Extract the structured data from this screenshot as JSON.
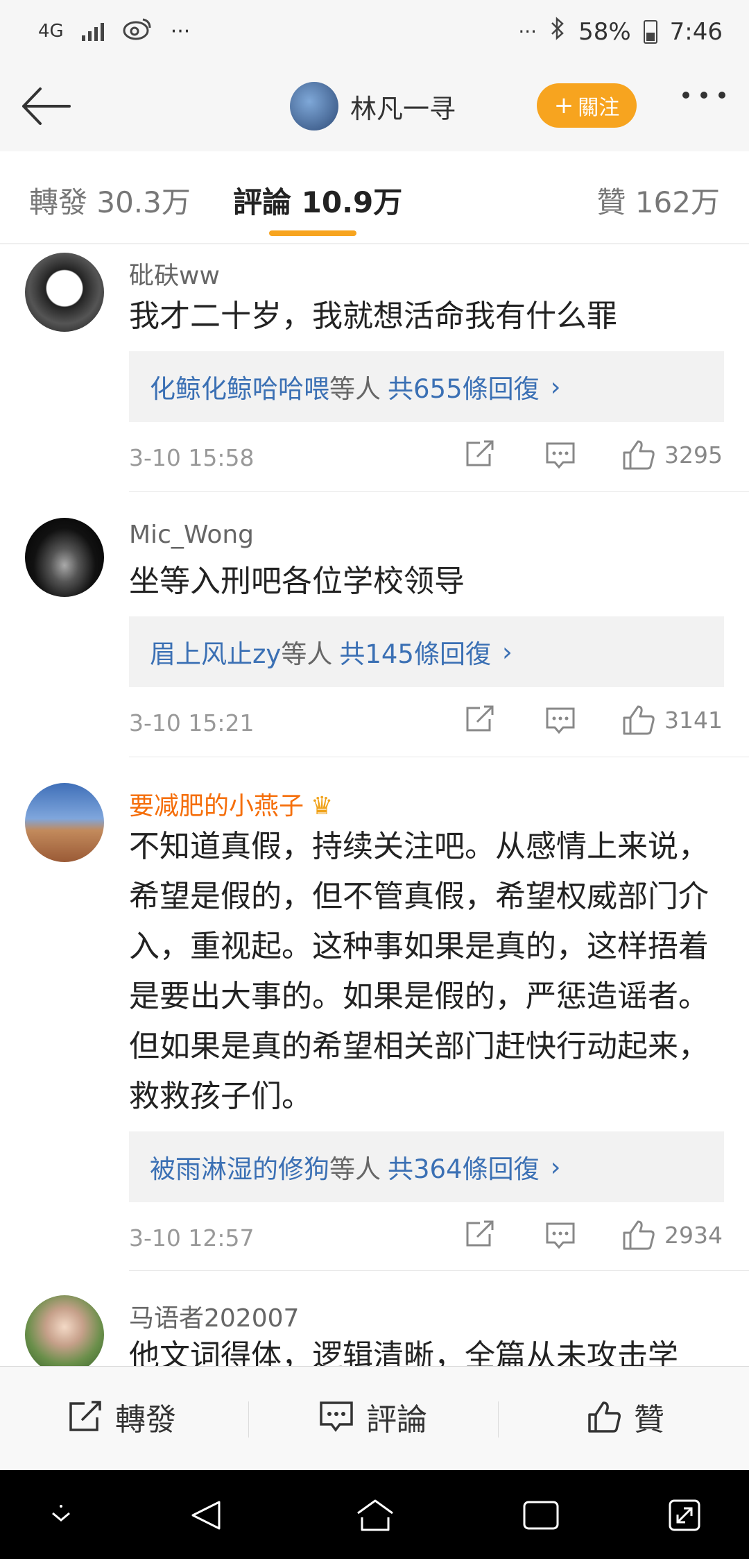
{
  "status_bar": {
    "network": "4G",
    "ellipsis": "···",
    "battery": "58%",
    "time": "7:46"
  },
  "header": {
    "user_name": "林凡一寻",
    "follow_label": "關注"
  },
  "tabs": [
    {
      "label": "轉發 30.3万"
    },
    {
      "label": "評論 10.9万"
    },
    {
      "label": "贊 162万"
    }
  ],
  "comments": [
    {
      "name": "砒砆ww",
      "text": "我才二十岁，我就想活命我有什么罪",
      "reply_users": "化鲸化鲸哈哈喂",
      "reply_mid": "等人",
      "reply_count": "共655條回復",
      "time": "3-10 15:58",
      "likes": "3295"
    },
    {
      "name": "Mic_Wong",
      "text": "坐等入刑吧各位学校领导",
      "reply_users": "眉上风止zy",
      "reply_mid": "等人",
      "reply_count": "共145條回復",
      "time": "3-10 15:21",
      "likes": "3141"
    },
    {
      "name": "要减肥的小燕子",
      "text": "不知道真假，持续关注吧。从感情上来说，希望是假的，但不管真假，希望权威部门介入，重视起。这种事如果是真的，这样捂着是要出大事的。如果是假的，严惩造谣者。但如果是真的希望相关部门赶快行动起来，救救孩子们。",
      "reply_users": "被雨淋湿的修狗",
      "reply_mid": "等人",
      "reply_count": "共364條回復",
      "time": "3-10 12:57",
      "likes": "2934"
    },
    {
      "name": "马语者202007",
      "text": "他文词得体，逻辑清晰，全篇从未攻击学"
    }
  ],
  "bottom_bar": {
    "repost": "轉發",
    "comment": "評論",
    "like": "贊"
  },
  "colors": {
    "accent": "#f7a41f",
    "link": "#3b70b4",
    "vip_name": "#f56e0a"
  }
}
